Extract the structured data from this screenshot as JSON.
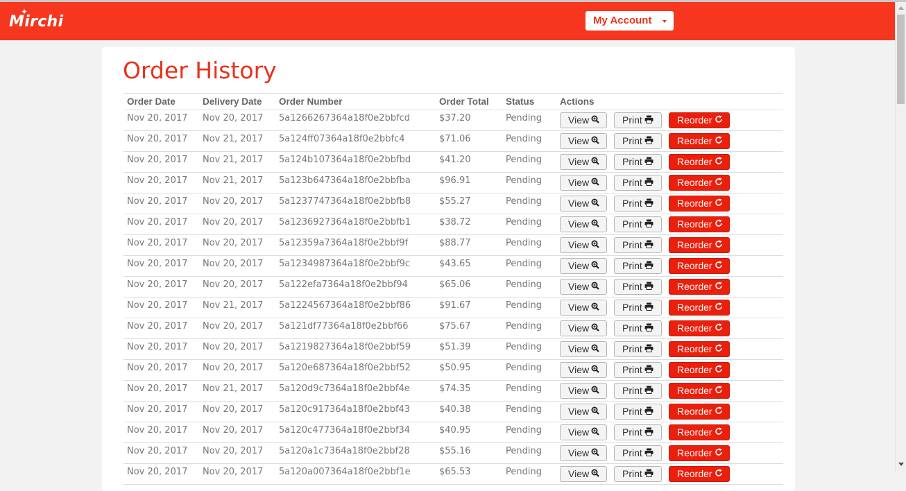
{
  "brand": {
    "name": "Mirchi"
  },
  "nav": {
    "account_label": "My Account"
  },
  "page": {
    "title": "Order History"
  },
  "table": {
    "headers": [
      "Order Date",
      "Delivery Date",
      "Order Number",
      "Order Total",
      "Status",
      "Actions"
    ],
    "actions": {
      "view": "View",
      "print": "Print",
      "reorder": "Reorder"
    },
    "rows": [
      {
        "order_date": "Nov 20, 2017",
        "delivery_date": "Nov 20, 2017",
        "order_number": "5a1266267364a18f0e2bbfcd",
        "total": "$37.20",
        "status": "Pending"
      },
      {
        "order_date": "Nov 20, 2017",
        "delivery_date": "Nov 21, 2017",
        "order_number": "5a124ff07364a18f0e2bbfc4",
        "total": "$71.06",
        "status": "Pending"
      },
      {
        "order_date": "Nov 20, 2017",
        "delivery_date": "Nov 21, 2017",
        "order_number": "5a124b107364a18f0e2bbfbd",
        "total": "$41.20",
        "status": "Pending"
      },
      {
        "order_date": "Nov 20, 2017",
        "delivery_date": "Nov 21, 2017",
        "order_number": "5a123b647364a18f0e2bbfba",
        "total": "$96.91",
        "status": "Pending"
      },
      {
        "order_date": "Nov 20, 2017",
        "delivery_date": "Nov 20, 2017",
        "order_number": "5a1237747364a18f0e2bbfb8",
        "total": "$55.27",
        "status": "Pending"
      },
      {
        "order_date": "Nov 20, 2017",
        "delivery_date": "Nov 20, 2017",
        "order_number": "5a1236927364a18f0e2bbfb1",
        "total": "$38.72",
        "status": "Pending"
      },
      {
        "order_date": "Nov 20, 2017",
        "delivery_date": "Nov 20, 2017",
        "order_number": "5a12359a7364a18f0e2bbf9f",
        "total": "$88.77",
        "status": "Pending"
      },
      {
        "order_date": "Nov 20, 2017",
        "delivery_date": "Nov 20, 2017",
        "order_number": "5a1234987364a18f0e2bbf9c",
        "total": "$43.65",
        "status": "Pending"
      },
      {
        "order_date": "Nov 20, 2017",
        "delivery_date": "Nov 20, 2017",
        "order_number": "5a122efa7364a18f0e2bbf94",
        "total": "$65.06",
        "status": "Pending"
      },
      {
        "order_date": "Nov 20, 2017",
        "delivery_date": "Nov 21, 2017",
        "order_number": "5a1224567364a18f0e2bbf86",
        "total": "$91.67",
        "status": "Pending"
      },
      {
        "order_date": "Nov 20, 2017",
        "delivery_date": "Nov 20, 2017",
        "order_number": "5a121df77364a18f0e2bbf66",
        "total": "$75.67",
        "status": "Pending"
      },
      {
        "order_date": "Nov 20, 2017",
        "delivery_date": "Nov 20, 2017",
        "order_number": "5a1219827364a18f0e2bbf59",
        "total": "$51.39",
        "status": "Pending"
      },
      {
        "order_date": "Nov 20, 2017",
        "delivery_date": "Nov 20, 2017",
        "order_number": "5a120e687364a18f0e2bbf52",
        "total": "$50.95",
        "status": "Pending"
      },
      {
        "order_date": "Nov 20, 2017",
        "delivery_date": "Nov 21, 2017",
        "order_number": "5a120d9c7364a18f0e2bbf4e",
        "total": "$74.35",
        "status": "Pending"
      },
      {
        "order_date": "Nov 20, 2017",
        "delivery_date": "Nov 20, 2017",
        "order_number": "5a120c917364a18f0e2bbf43",
        "total": "$40.38",
        "status": "Pending"
      },
      {
        "order_date": "Nov 20, 2017",
        "delivery_date": "Nov 20, 2017",
        "order_number": "5a120c477364a18f0e2bbf34",
        "total": "$40.95",
        "status": "Pending"
      },
      {
        "order_date": "Nov 20, 2017",
        "delivery_date": "Nov 20, 2017",
        "order_number": "5a120a1c7364a18f0e2bbf28",
        "total": "$55.16",
        "status": "Pending"
      },
      {
        "order_date": "Nov 20, 2017",
        "delivery_date": "Nov 20, 2017",
        "order_number": "5a120a007364a18f0e2bbf1e",
        "total": "$65.53",
        "status": "Pending"
      }
    ]
  },
  "icons": {
    "view": "search-plus-icon",
    "print": "printer-icon",
    "reorder": "refresh-icon"
  },
  "colors": {
    "brand": "#f6361e",
    "title": "#e8321c",
    "reorder_button": "#ea1f0c"
  }
}
